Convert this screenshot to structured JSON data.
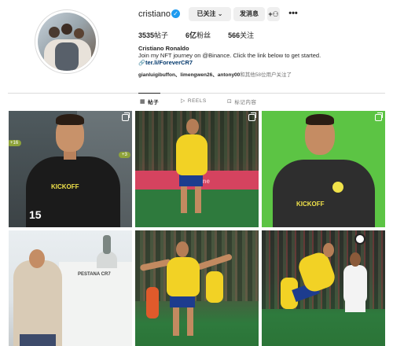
{
  "profile": {
    "username": "cristiano",
    "verified_icon": "✓",
    "buttons": {
      "following": "已关注 ⌄",
      "message": "发消息",
      "add_user_icon": "+⚇",
      "more_icon": "•••"
    },
    "stats": {
      "posts": "3535",
      "posts_label": "帖子",
      "followers": "6亿",
      "followers_label": "粉丝",
      "following": "566",
      "following_label": "关注"
    },
    "full_name": "Cristiano Ronaldo",
    "bio": "Join my NFT journey on @Binance. Click the link below to get started.",
    "link_icon": "🔗",
    "link": "ter.li/ForeverCR7",
    "followed_by": {
      "names": "gianluigibuffon、limengwen26、antony00",
      "suffix": "和其他58位用户关注了"
    }
  },
  "tabs": [
    {
      "icon": "▦",
      "label": "帖子"
    },
    {
      "icon": "▷",
      "label": "REELS"
    },
    {
      "icon": "⊡",
      "label": "标记内容"
    }
  ],
  "grid": {
    "tile1": {
      "pill1": "+16",
      "pill2": "+3",
      "number": "15",
      "logo": "KICKOFF"
    },
    "tile3": {
      "logo": "KICKOFF"
    },
    "tile4": {
      "sign": "PESTANA CR7"
    },
    "tile2": {
      "adtext": "Airline"
    }
  },
  "colors": {
    "accent_link": "#00376b",
    "verified": "#1d9bf0",
    "button_bg": "#efefef"
  }
}
